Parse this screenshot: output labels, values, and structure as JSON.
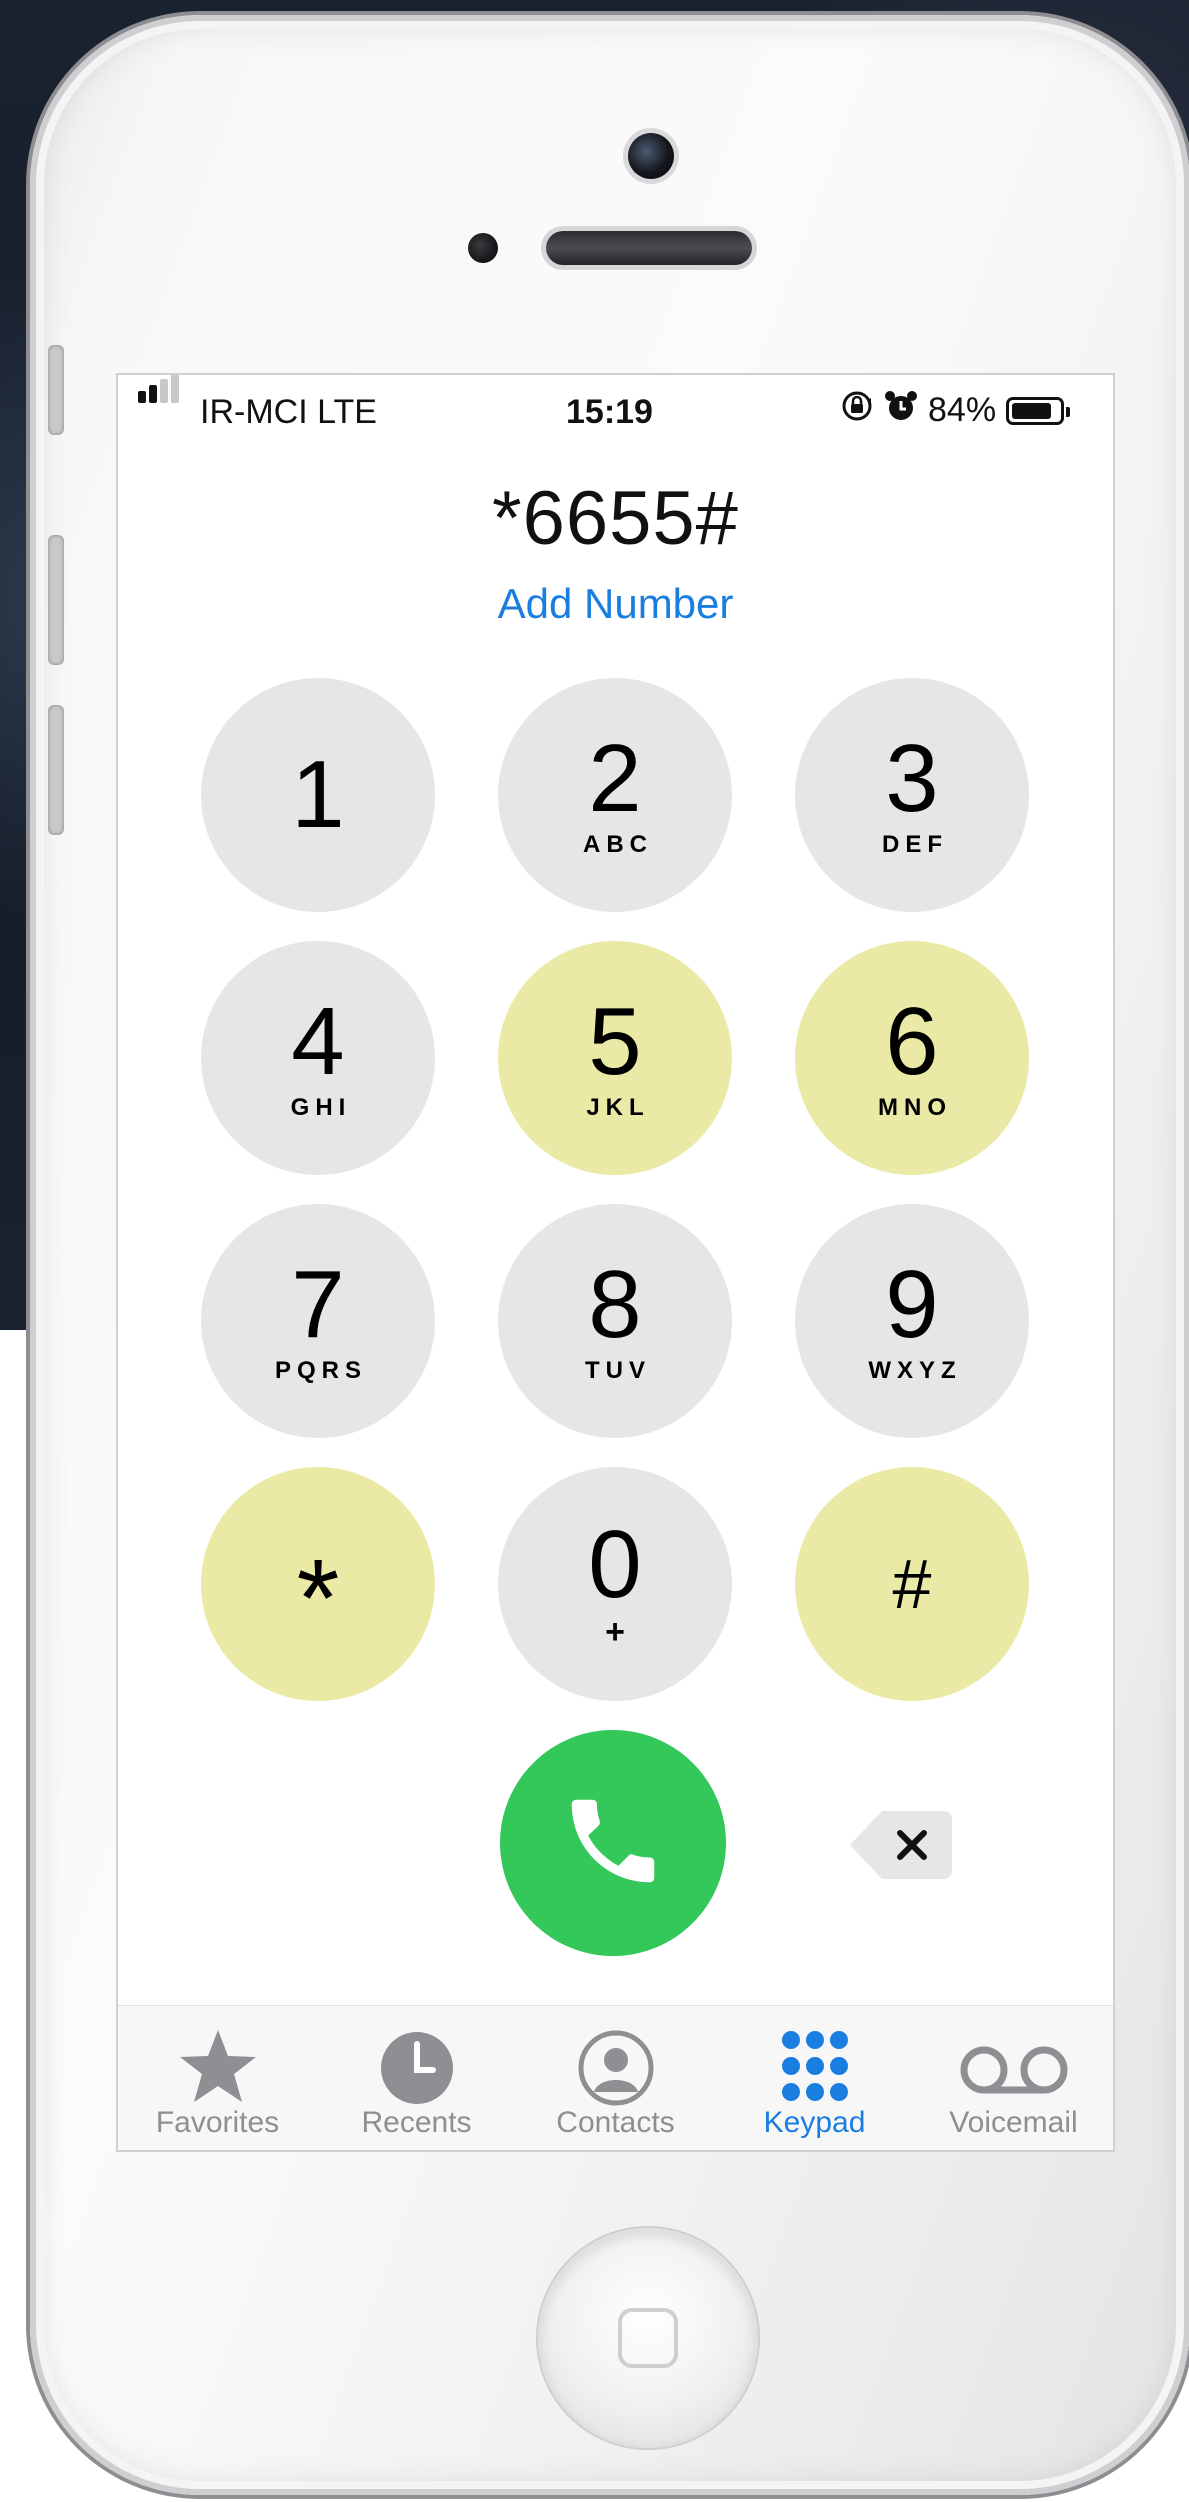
{
  "status_bar": {
    "carrier": "IR-MCI  LTE",
    "time": "15:19",
    "battery_percent": "84%",
    "battery_level": 0.84,
    "signal_bars": 2,
    "icons": [
      "signal-icon",
      "rotation-lock-icon",
      "alarm-icon",
      "battery-icon"
    ]
  },
  "dialer": {
    "number": "*6655#",
    "add_number": "Add Number"
  },
  "colors": {
    "key_default": "#e6e6e7",
    "key_pressed": "#eaeaa6",
    "call_green": "#34c759",
    "accent_blue": "#1a7ee0",
    "tab_inactive": "#8e8e93"
  },
  "keypad": {
    "keys": [
      {
        "digit": "1",
        "letters": "",
        "pressed": false
      },
      {
        "digit": "2",
        "letters": "ABC",
        "pressed": false
      },
      {
        "digit": "3",
        "letters": "DEF",
        "pressed": false
      },
      {
        "digit": "4",
        "letters": "GHI",
        "pressed": false
      },
      {
        "digit": "5",
        "letters": "JKL",
        "pressed": true
      },
      {
        "digit": "6",
        "letters": "MNO",
        "pressed": true
      },
      {
        "digit": "7",
        "letters": "PQRS",
        "pressed": false
      },
      {
        "digit": "8",
        "letters": "TUV",
        "pressed": false
      },
      {
        "digit": "9",
        "letters": "WXYZ",
        "pressed": false
      },
      {
        "digit": "*",
        "letters": "",
        "pressed": true
      },
      {
        "digit": "0",
        "letters": "+",
        "pressed": false
      },
      {
        "digit": "#",
        "letters": "",
        "pressed": true
      }
    ],
    "call_icon": "phone-icon",
    "delete_icon": "delete-icon"
  },
  "tabbar": {
    "active": "Keypad",
    "tabs": [
      {
        "label": "Favorites",
        "icon": "star-icon"
      },
      {
        "label": "Recents",
        "icon": "clock-icon"
      },
      {
        "label": "Contacts",
        "icon": "person-circle-icon"
      },
      {
        "label": "Keypad",
        "icon": "keypad-grid-icon"
      },
      {
        "label": "Voicemail",
        "icon": "voicemail-icon"
      }
    ]
  }
}
